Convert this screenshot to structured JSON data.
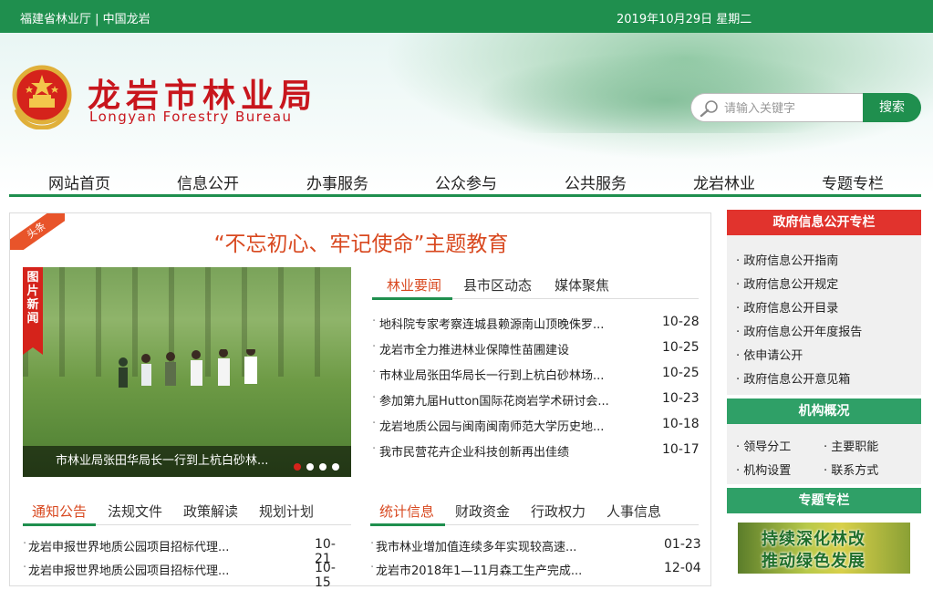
{
  "topbar": {
    "left_text": "福建省林业厅 | 中国龙岩",
    "date": "2019年10月29日 星期二"
  },
  "header": {
    "title": "龙岩市林业局",
    "subtitle": "Longyan Forestry Bureau"
  },
  "search": {
    "placeholder": "请输入关键字",
    "button": "搜索"
  },
  "nav": [
    "网站首页",
    "信息公开",
    "办事服务",
    "公众参与",
    "公共服务",
    "龙岩林业",
    "专题专栏"
  ],
  "featured": {
    "badge": "头条",
    "headline": "“不忘初心、牢记使命”主题教育"
  },
  "photo": {
    "tag": "图片新闻",
    "caption": "市林业局张田华局长一行到上杭白砂林..."
  },
  "news_tabs": [
    "林业要闻",
    "县市区动态",
    "媒体聚焦"
  ],
  "news": [
    {
      "title": "地科院专家考察连城县赖源南山顶晚侏罗...",
      "date": "10-28"
    },
    {
      "title": "龙岩市全力推进林业保障性苗圃建设",
      "date": "10-25"
    },
    {
      "title": "市林业局张田华局长一行到上杭白砂林场...",
      "date": "10-25"
    },
    {
      "title": "参加第九届Hutton国际花岗岩学术研讨会...",
      "date": "10-23"
    },
    {
      "title": "龙岩地质公园与闽南闽南师范大学历史地...",
      "date": "10-18"
    },
    {
      "title": "我市民营花卉企业科技创新再出佳绩",
      "date": "10-17"
    }
  ],
  "notice_tabs": [
    "通知公告",
    "法规文件",
    "政策解读",
    "规划计划"
  ],
  "notices": [
    {
      "title": "龙岩申报世界地质公园项目招标代理...",
      "date": "10-21"
    },
    {
      "title": "龙岩申报世界地质公园项目招标代理...",
      "date": "10-15"
    }
  ],
  "stats_tabs": [
    "统计信息",
    "财政资金",
    "行政权力",
    "人事信息"
  ],
  "stats": [
    {
      "title": "我市林业增加值连续多年实现较高速...",
      "date": "01-23"
    },
    {
      "title": "龙岩市2018年1—11月森工生产完成...",
      "date": "12-04"
    }
  ],
  "sidebar": {
    "gov_title": "政府信息公开专栏",
    "gov_links": [
      "政府信息公开指南",
      "政府信息公开规定",
      "政府信息公开目录",
      "政府信息公开年度报告",
      "依申请公开",
      "政府信息公开意见箱"
    ],
    "org_title": "机构概况",
    "org_links": [
      "领导分工",
      "主要职能",
      "机构设置",
      "联系方式"
    ],
    "special_title": "专题专栏",
    "promo_line1": "持续深化林改",
    "promo_line2": "推动绿色发展"
  },
  "colors": {
    "green": "#1f8f4e",
    "red": "#c8161d",
    "sidebar_red": "#e1332d",
    "sidebar_green": "#2fa067"
  }
}
